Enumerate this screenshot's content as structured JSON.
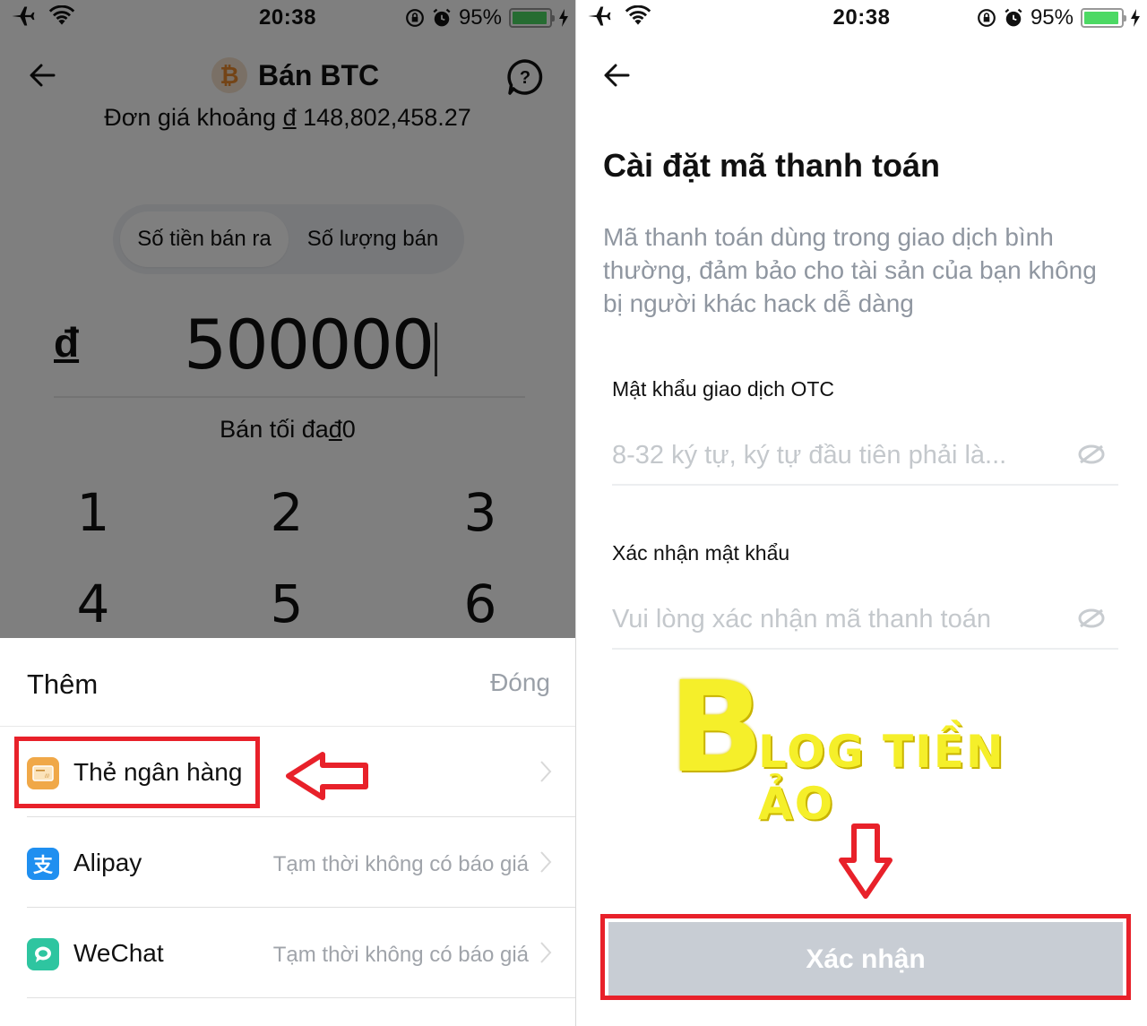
{
  "status_bar": {
    "time": "20:38",
    "battery_percent_label": "95%",
    "battery_level": 0.95,
    "icons": [
      "airplane-icon",
      "wifi-icon",
      "rotation-lock-icon",
      "alarm-icon",
      "battery-icon",
      "charging-icon"
    ]
  },
  "left_screen": {
    "nav": {
      "back_icon": "arrow-left-icon",
      "coin_symbol": "₿",
      "title": "Bán BTC",
      "help_icon": "question-bubble-icon"
    },
    "unit_price_prefix": "Đơn giá khoảng",
    "unit_price_currency": "đ",
    "unit_price_value": "148,802,458.27",
    "mode_tabs": [
      {
        "label": "Số tiền bán ra",
        "active": true
      },
      {
        "label": "Số lượng bán",
        "active": false
      }
    ],
    "amount_currency": "đ",
    "amount_value": "500000",
    "max_sell_prefix": "Bán tối đa",
    "max_sell_currency": "đ",
    "max_sell_value": "0",
    "keypad": [
      "1",
      "2",
      "3",
      "4",
      "5",
      "6"
    ],
    "sheet": {
      "title": "Thêm",
      "close_label": "Đóng",
      "items": [
        {
          "label": "Thẻ ngân hàng",
          "status": "",
          "icon": "bank-card-icon",
          "icon_color": "#f0a848"
        },
        {
          "label": "Alipay",
          "status": "Tạm thời không có báo giá",
          "icon": "alipay-icon",
          "icon_color": "#1f8ff0",
          "glyph": "支"
        },
        {
          "label": "WeChat",
          "status": "Tạm thời không có báo giá",
          "icon": "wechat-icon",
          "icon_color": "#2ec5a0"
        }
      ]
    }
  },
  "right_screen": {
    "back_icon": "arrow-left-icon",
    "title": "Cài đặt mã thanh toán",
    "description": "Mã thanh toán dùng trong giao dịch bình thường, đảm bảo cho tài sản của bạn không bị người khác hack dễ dàng",
    "fields": [
      {
        "label": "Mật khẩu giao dịch OTC",
        "value": "",
        "placeholder": "8-32 ký tự, ký tự đầu tiên phải là...",
        "icon": "eye-hidden-icon"
      },
      {
        "label": "Xác nhận mật khẩu",
        "value": "",
        "placeholder": "Vui lòng xác nhận mã thanh toán",
        "icon": "eye-hidden-icon"
      }
    ],
    "watermark": {
      "letter": "B",
      "text": "LOG TIỀN ẢO"
    },
    "confirm_label": "Xác nhận"
  },
  "annotations": {
    "color": "#e8212a"
  }
}
